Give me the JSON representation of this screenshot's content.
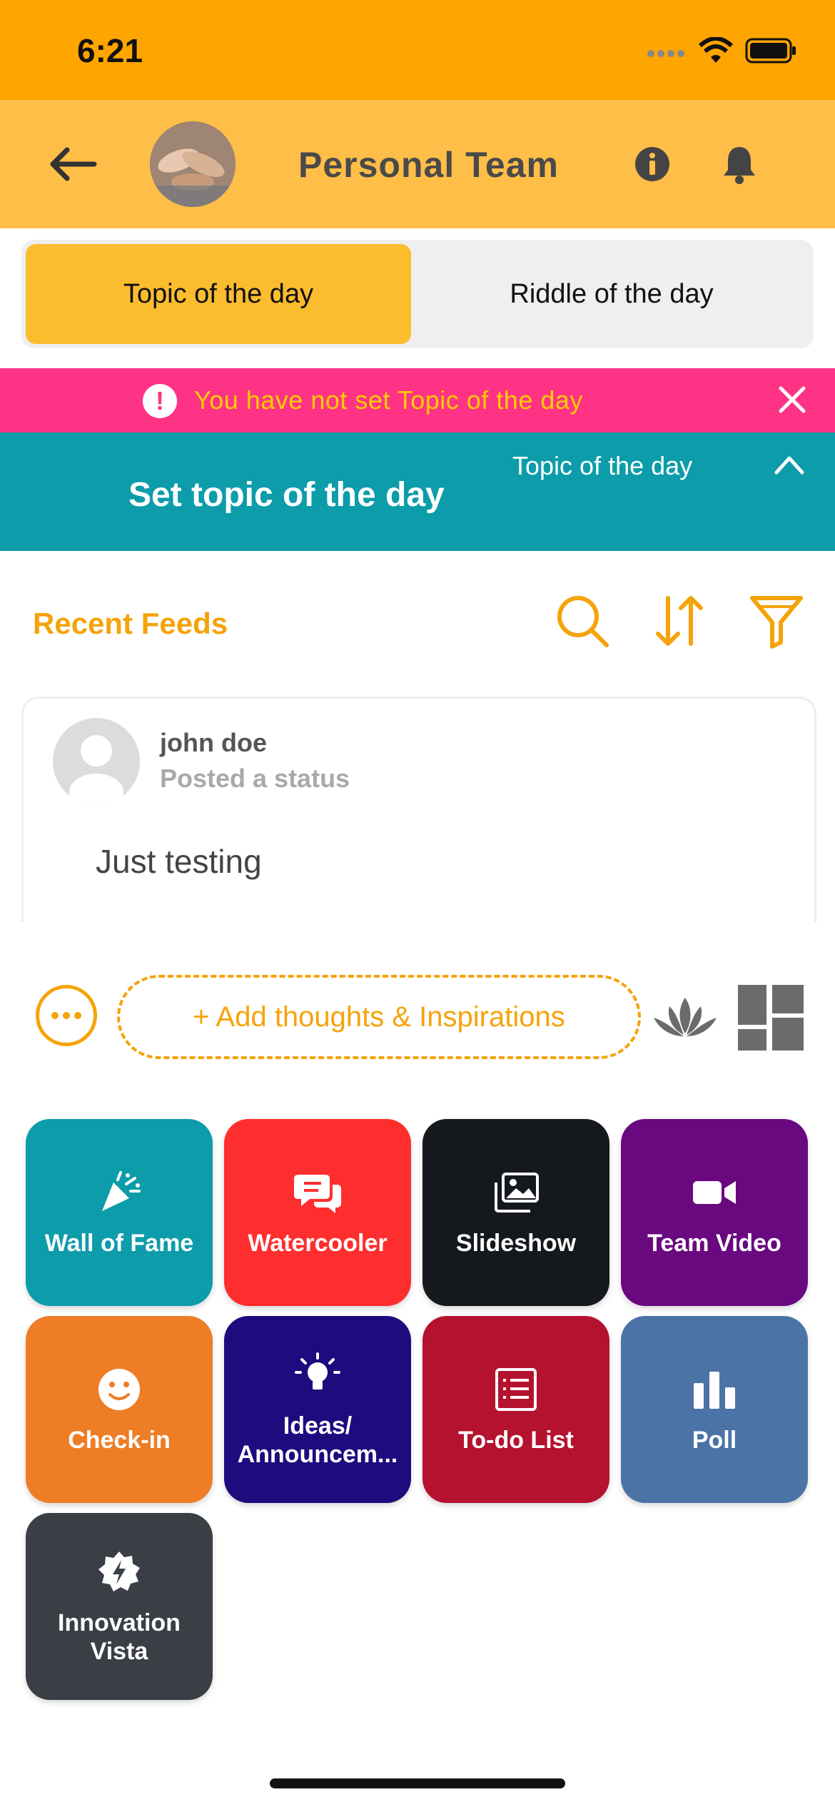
{
  "status_bar": {
    "time": "6:21"
  },
  "header": {
    "title": "Personal Team"
  },
  "tabs": [
    {
      "label": "Topic of the day",
      "active": true
    },
    {
      "label": "Riddle of the day",
      "active": false
    }
  ],
  "alert": {
    "text": "You have not set Topic of the day",
    "icon": "!"
  },
  "topic_panel": {
    "main": "Set topic of the day",
    "sub": "Topic of the day"
  },
  "feeds": {
    "title": "Recent Feeds"
  },
  "post": {
    "author": "john doe",
    "action": "Posted a status",
    "body": "Just testing"
  },
  "composer": {
    "placeholder": "+ Add thoughts & Inspirations"
  },
  "tiles": [
    {
      "label": "Wall of Fame",
      "color": "#0D9CAA",
      "icon": "party-popper-icon"
    },
    {
      "label": "Watercooler",
      "color": "#FF2E2E",
      "icon": "chat-bubbles-icon"
    },
    {
      "label": "Slideshow",
      "color": "#15181C",
      "icon": "images-icon"
    },
    {
      "label": "Team Video",
      "color": "#6A0880",
      "icon": "video-camera-icon"
    },
    {
      "label": "Check-in",
      "color": "#EE7D26",
      "icon": "smiley-icon"
    },
    {
      "label": "Ideas/ Announcem...",
      "color": "#1C0C7E",
      "icon": "lightbulb-icon"
    },
    {
      "label": "To-do List",
      "color": "#B4122F",
      "icon": "list-icon"
    },
    {
      "label": "Poll",
      "color": "#4B73A6",
      "icon": "bar-chart-icon"
    },
    {
      "label": "Innovation Vista",
      "color": "#3A3E45",
      "icon": "innovation-badge-icon"
    }
  ],
  "colors": {
    "orange": "#FFA500",
    "header": "#FFBE47",
    "alert": "#FF3385",
    "teal": "#0D9CAA",
    "accent": "#F5A30A"
  }
}
